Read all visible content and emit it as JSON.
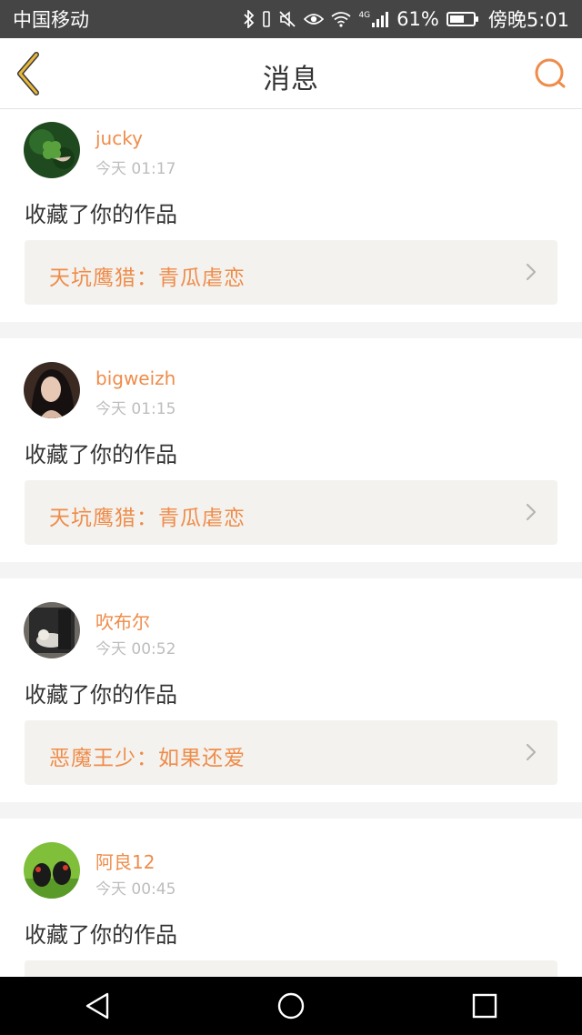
{
  "status_bar": {
    "carrier": "中国移动",
    "network": "4G",
    "battery_percent": "61%",
    "battery_level": 0.61,
    "time": "傍晚5:01"
  },
  "header": {
    "title": "消息",
    "back_icon": "chevron-left-icon",
    "search_icon": "search-icon"
  },
  "colors": {
    "accent": "#ef8c4a",
    "back_arrow": "#e9b83a",
    "card_bg": "#f3f2ee"
  },
  "messages": [
    {
      "username": "jucky",
      "time": "今天 01:17",
      "action": "收藏了你的作品",
      "work_title": "天坑鹰猎：青瓜虐恋"
    },
    {
      "username": "bigweizh",
      "time": "今天 01:15",
      "action": "收藏了你的作品",
      "work_title": "天坑鹰猎：青瓜虐恋"
    },
    {
      "username": "吹布尔",
      "time": "今天 00:52",
      "action": "收藏了你的作品",
      "work_title": "恶魔王少：如果还爱"
    },
    {
      "username": "阿良12",
      "time": "今天 00:45",
      "action": "收藏了你的作品",
      "work_title": ""
    }
  ],
  "nav_bar": {
    "back": "triangle-back-icon",
    "home": "circle-home-icon",
    "recents": "square-recents-icon"
  }
}
